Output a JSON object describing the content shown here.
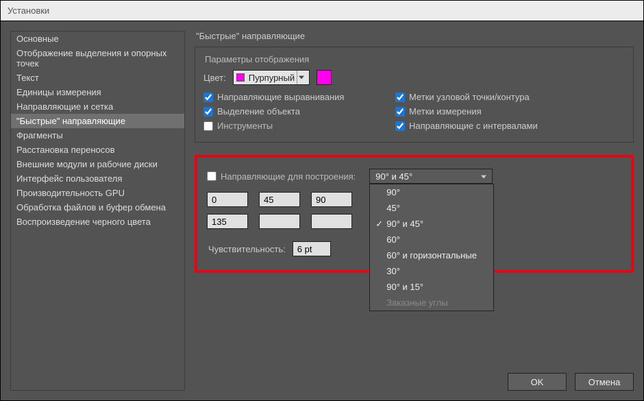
{
  "titlebar": "Установки",
  "sidebar": {
    "items": [
      {
        "label": "Основные"
      },
      {
        "label": "Отображение выделения и опорных точек"
      },
      {
        "label": "Текст"
      },
      {
        "label": "Единицы измерения"
      },
      {
        "label": "Направляющие и сетка"
      },
      {
        "label": "\"Быстрые\" направляющие",
        "selected": true
      },
      {
        "label": "Фрагменты"
      },
      {
        "label": "Расстановка переносов"
      },
      {
        "label": "Внешние модули и рабочие диски"
      },
      {
        "label": "Интерфейс пользователя"
      },
      {
        "label": "Производительность GPU"
      },
      {
        "label": "Обработка файлов и буфер обмена"
      },
      {
        "label": "Воспроизведение черного цвета"
      }
    ]
  },
  "content": {
    "heading": "\"Быстрые\" направляющие",
    "fieldset_legend": "Параметры отображения",
    "color_label": "Цвет:",
    "color_value": "Пурпурный",
    "swatch_hex": "#ff00ef",
    "checks": [
      {
        "label": "Направляющие выравнивания",
        "checked": true
      },
      {
        "label": "Метки узловой точки/контура",
        "checked": true
      },
      {
        "label": "Выделение объекта",
        "checked": true
      },
      {
        "label": "Метки измерения",
        "checked": true
      },
      {
        "label": "Инструменты",
        "checked": false
      },
      {
        "label": "Направляющие с интервалами",
        "checked": true
      }
    ],
    "construct_label": "Направляющие для построения:",
    "construct_checked": false,
    "angle_dd_value": "90° и 45°",
    "angle_options": [
      {
        "label": "90°"
      },
      {
        "label": "45°"
      },
      {
        "label": "90° и 45°",
        "selected": true
      },
      {
        "label": "60°"
      },
      {
        "label": "60° и горизонтальные"
      },
      {
        "label": "30°"
      },
      {
        "label": "90° и 15°"
      },
      {
        "label": "Заказные углы",
        "disabled": true
      }
    ],
    "angles": [
      "0",
      "45",
      "90",
      "135",
      "",
      ""
    ],
    "sensitivity_label": "Чувствительность:",
    "sensitivity_value": "6 pt"
  },
  "footer": {
    "ok": "OK",
    "cancel": "Отмена"
  }
}
